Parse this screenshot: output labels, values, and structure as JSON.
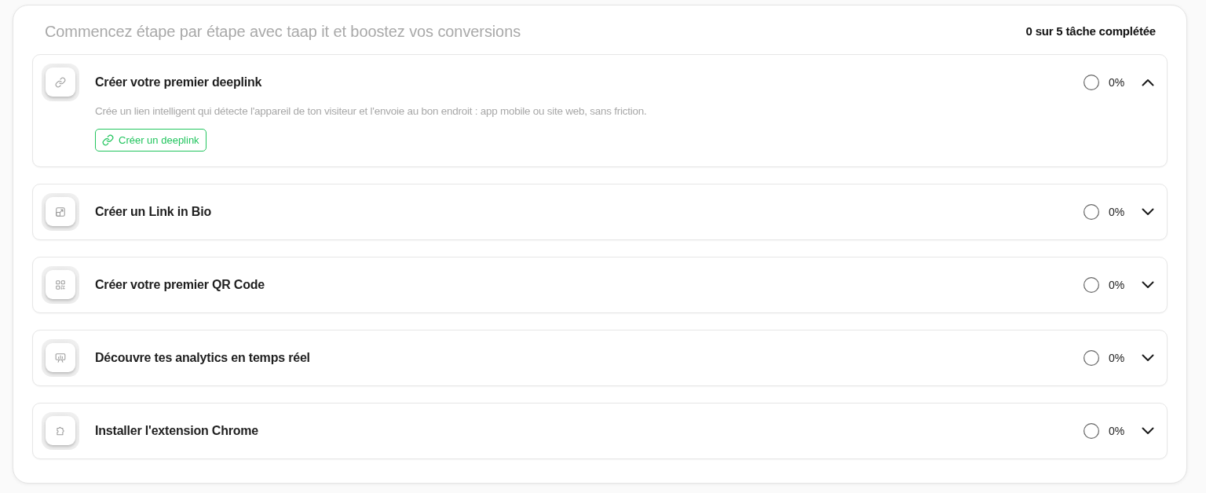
{
  "header": {
    "title": "Commencez étape par étape avec taap it et boostez vos conversions",
    "progress": "0 sur 5 tâche complétée"
  },
  "tasks": [
    {
      "kind": "link",
      "title": "Créer votre premier deeplink",
      "completed": false,
      "percent": "0%",
      "expanded": true,
      "description": "Crée un lien intelligent qui détecte l'appareil de ton visiteur et l'envoie au bon endroit : app mobile ou site web, sans friction.",
      "action": {
        "label": "Créer un deeplink"
      }
    },
    {
      "kind": "bio",
      "title": "Créer un Link in Bio",
      "completed": false,
      "percent": "0%",
      "expanded": false
    },
    {
      "kind": "qrcode",
      "title": "Créer votre premier QR Code",
      "completed": false,
      "percent": "0%",
      "expanded": false
    },
    {
      "kind": "analytics",
      "title": "Découvre tes analytics en temps réel",
      "completed": false,
      "percent": "0%",
      "expanded": false
    },
    {
      "kind": "extension",
      "title": "Installer l'extension Chrome",
      "completed": false,
      "percent": "0%",
      "expanded": false
    }
  ]
}
